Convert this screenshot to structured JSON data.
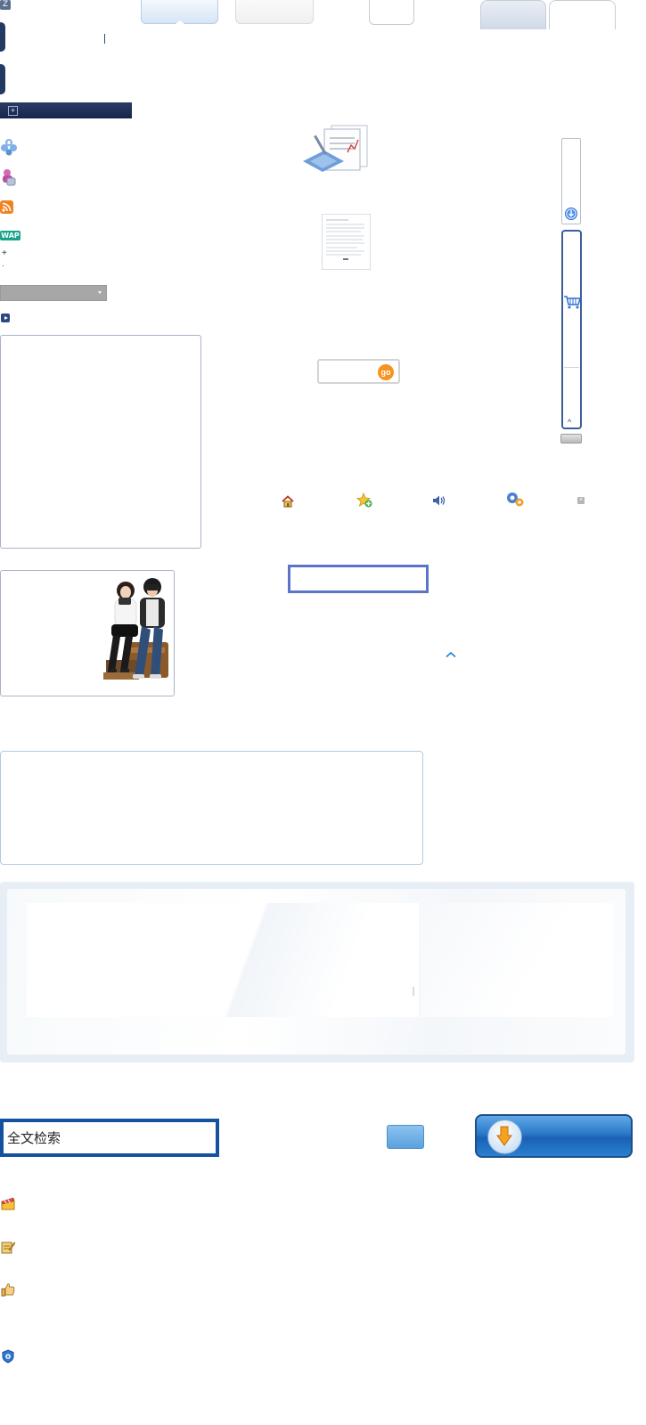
{
  "header": {
    "logo_letter": "Z"
  },
  "search": {
    "placeholder": "全文检索",
    "value": "全文检索"
  },
  "toolbar": {
    "icons": [
      "home-icon",
      "add-favorite-icon",
      "volume-icon",
      "settings-icon",
      "close-icon"
    ]
  },
  "sidebar": {
    "icons": [
      "gamepad-icon",
      "user-group-icon",
      "rss-icon",
      "wap-icon"
    ],
    "wap_label": "WAP"
  },
  "go_button": {
    "label": "go"
  },
  "bottom_list": {
    "icons": [
      "clapperboard-icon",
      "note-edit-icon",
      "thumbs-up-icon",
      "shield-icon"
    ]
  },
  "colors": {
    "nav_dark": "#1c2c55",
    "accent_blue": "#1452a0",
    "go_orange": "#f7931e"
  }
}
